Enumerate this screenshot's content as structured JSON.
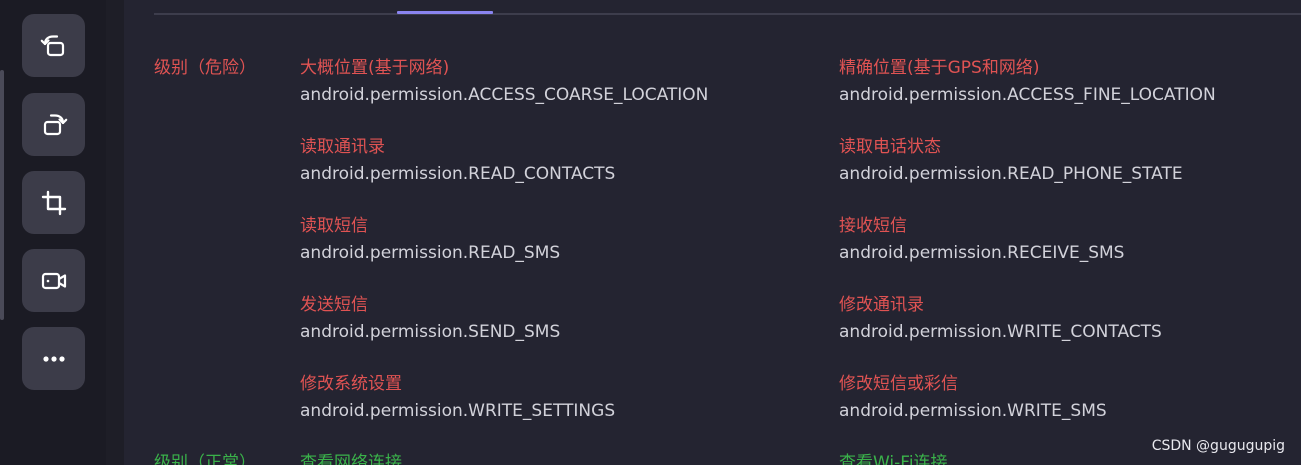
{
  "toolbar": {
    "buttons": [
      {
        "icon": "rotate-counterclockwise-icon"
      },
      {
        "icon": "rotate-clockwise-icon"
      },
      {
        "icon": "crop-icon"
      },
      {
        "icon": "video-icon"
      },
      {
        "icon": "more-options-icon"
      }
    ]
  },
  "colors": {
    "danger": "#e05353",
    "normal": "#3ab24a",
    "accent": "#8a84f0",
    "permission_text": "#d2d2da"
  },
  "levels": {
    "danger_label": "级别（危险）",
    "normal_label": "级别（正常）"
  },
  "permissions": {
    "danger": [
      {
        "name": "大概位置(基于网络)",
        "id": "android.permission.ACCESS_COARSE_LOCATION"
      },
      {
        "name": "精确位置(基于GPS和网络)",
        "id": "android.permission.ACCESS_FINE_LOCATION"
      },
      {
        "name": "读取通讯录",
        "id": "android.permission.READ_CONTACTS"
      },
      {
        "name": "读取电话状态",
        "id": "android.permission.READ_PHONE_STATE"
      },
      {
        "name": "读取短信",
        "id": "android.permission.READ_SMS"
      },
      {
        "name": "接收短信",
        "id": "android.permission.RECEIVE_SMS"
      },
      {
        "name": "发送短信",
        "id": "android.permission.SEND_SMS"
      },
      {
        "name": "修改通讯录",
        "id": "android.permission.WRITE_CONTACTS"
      },
      {
        "name": "修改系统设置",
        "id": "android.permission.WRITE_SETTINGS"
      },
      {
        "name": "修改短信或彩信",
        "id": "android.permission.WRITE_SMS"
      }
    ],
    "normal": [
      {
        "name": "查看网络连接"
      },
      {
        "name": "查看Wi-Fi连接"
      }
    ]
  },
  "watermark": "CSDN @gugugupig"
}
